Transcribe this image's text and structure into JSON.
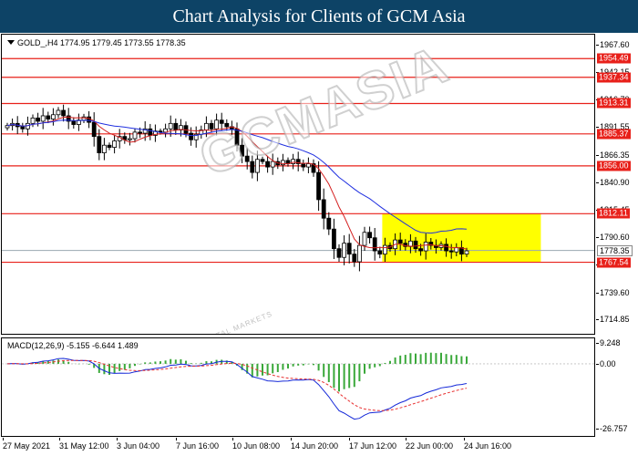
{
  "banner": {
    "title": "Chart Analysis for Clients of GCM Asia"
  },
  "symbol_info": "GOLD_,H4  1774.95 1779.45 1773.55 1778.35",
  "macd_info": "MACD(12,26,9) -5.155 -6.644 1.489",
  "watermark": {
    "text": "GCMASIA",
    "sub": "GLOBAL CAPITAL MARKETS"
  },
  "colors": {
    "banner": "#0d4366",
    "level_line": "#e8201a",
    "zone": "#ffff00",
    "ma_fast": "#d42020",
    "ma_slow": "#2030e0",
    "macd_line": "#1428d8",
    "signal_line": "#e83030",
    "histogram": "#3aa83a",
    "candle": "#000000"
  },
  "chart_data": [
    {
      "type": "candlestick",
      "title": "GOLD_,H4",
      "ohlc_last": {
        "open": 1774.95,
        "high": 1779.45,
        "low": 1773.55,
        "close": 1778.35
      },
      "ylim": [
        1700.17,
        1976.5
      ],
      "y_ticks": [
        1967.6,
        1942.15,
        1916.7,
        1891.55,
        1866.35,
        1840.9,
        1815.45,
        1790.6,
        1765.15,
        1739.6,
        1714.85
      ],
      "x_ticks": [
        "27 May 2021",
        "31 May 12:00",
        "3 Jun 04:00",
        "7 Jun 16:00",
        "10 Jun 08:00",
        "14 Jun 20:00",
        "17 Jun 12:00",
        "22 Jun 00:00",
        "24 Jun 16:00"
      ],
      "horizontal_levels": [
        1954.49,
        1937.34,
        1913.31,
        1885.37,
        1856.0,
        1812.11,
        1767.54
      ],
      "current_price": 1778.35,
      "zone": {
        "y_from": 1767.54,
        "y_to": 1812.11,
        "x_from_bar": 74,
        "x_to_bar": 104
      },
      "closes": [
        1893,
        1895,
        1892,
        1890,
        1895,
        1900,
        1897,
        1902,
        1899,
        1903,
        1907,
        1902,
        1897,
        1894,
        1898,
        1901,
        1896,
        1883,
        1868,
        1875,
        1873,
        1879,
        1883,
        1880,
        1881,
        1887,
        1886,
        1890,
        1884,
        1888,
        1887,
        1890,
        1895,
        1889,
        1893,
        1886,
        1880,
        1885,
        1889,
        1895,
        1890,
        1898,
        1895,
        1892,
        1890,
        1875,
        1865,
        1860,
        1850,
        1862,
        1860,
        1855,
        1860,
        1857,
        1861,
        1858,
        1862,
        1858,
        1855,
        1858,
        1850,
        1825,
        1808,
        1798,
        1780,
        1772,
        1785,
        1775,
        1768,
        1783,
        1795,
        1790,
        1778,
        1775,
        1783,
        1780,
        1788,
        1785,
        1782,
        1787,
        1780,
        1778,
        1786,
        1783,
        1781,
        1784,
        1778,
        1777,
        1781,
        1775,
        1778
      ]
    },
    {
      "type": "macd",
      "title": "MACD(12,26,9)",
      "values": {
        "macd": -5.155,
        "signal": -6.644,
        "histogram": 1.489
      },
      "ylim": [
        -30.5,
        10.5
      ],
      "y_ticks": [
        9.248,
        0.0,
        -26.757
      ]
    }
  ]
}
